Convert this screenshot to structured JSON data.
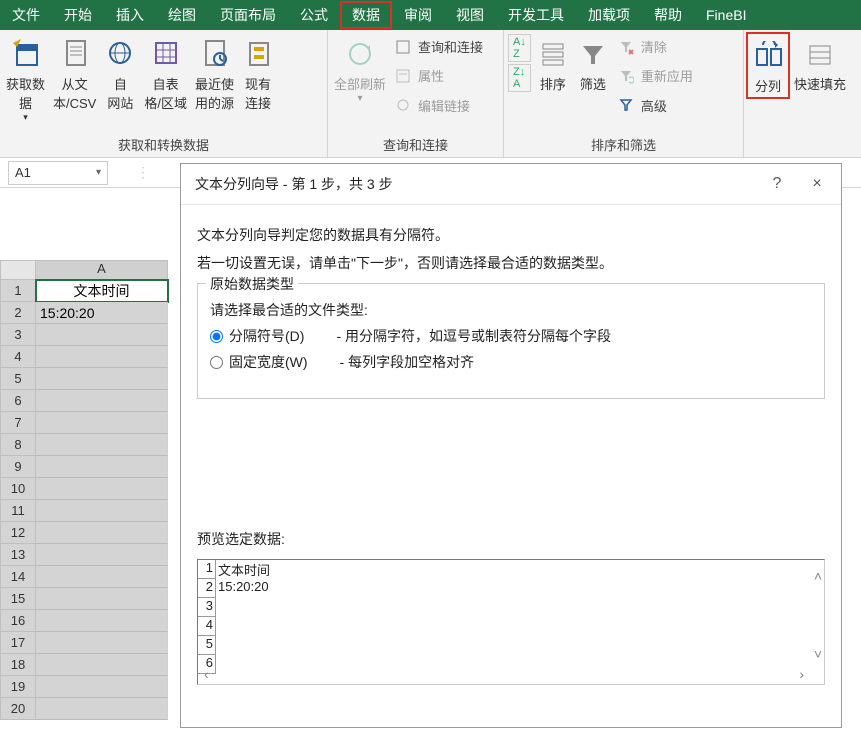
{
  "menu": {
    "items": [
      "文件",
      "开始",
      "插入",
      "绘图",
      "页面布局",
      "公式",
      "数据",
      "审阅",
      "视图",
      "开发工具",
      "加载项",
      "帮助",
      "FineBI"
    ],
    "highlightedIndex": 6
  },
  "ribbon": {
    "groups": [
      {
        "label": "获取和转换数据",
        "buttons": [
          {
            "label": "获取数\n据",
            "name": "get-data-button"
          },
          {
            "label": "从文\n本/CSV",
            "name": "from-text-csv-button"
          },
          {
            "label": "自\n网站",
            "name": "from-web-button"
          },
          {
            "label": "自表\n格/区域",
            "name": "from-table-range-button"
          },
          {
            "label": "最近使\n用的源",
            "name": "recent-sources-button"
          },
          {
            "label": "现有\n连接",
            "name": "existing-connections-button"
          }
        ]
      },
      {
        "label": "查询和连接",
        "refreshAll": "全部刷新",
        "small": [
          {
            "label": "查询和连接",
            "name": "queries-connections-button"
          },
          {
            "label": "属性",
            "name": "properties-button",
            "disabled": true
          },
          {
            "label": "编辑链接",
            "name": "edit-links-button",
            "disabled": true
          }
        ]
      },
      {
        "label": "排序和筛选",
        "sort": "排序",
        "filter": "筛选",
        "small": [
          {
            "label": "清除",
            "name": "clear-button",
            "disabled": true
          },
          {
            "label": "重新应用",
            "name": "reapply-button",
            "disabled": true
          },
          {
            "label": "高级",
            "name": "advanced-button"
          }
        ]
      },
      {
        "textToColumns": "分列",
        "flashFill": "快速填充"
      }
    ]
  },
  "nameBox": {
    "value": "A1"
  },
  "sheet": {
    "columnHeader": "A",
    "rows": [
      {
        "n": 1,
        "v": "文本时间"
      },
      {
        "n": 2,
        "v": "15:20:20"
      },
      {
        "n": 3,
        "v": ""
      },
      {
        "n": 4,
        "v": ""
      },
      {
        "n": 5,
        "v": ""
      },
      {
        "n": 6,
        "v": ""
      },
      {
        "n": 7,
        "v": ""
      },
      {
        "n": 8,
        "v": ""
      },
      {
        "n": 9,
        "v": ""
      },
      {
        "n": 10,
        "v": ""
      },
      {
        "n": 11,
        "v": ""
      },
      {
        "n": 12,
        "v": ""
      },
      {
        "n": 13,
        "v": ""
      },
      {
        "n": 14,
        "v": ""
      },
      {
        "n": 15,
        "v": ""
      },
      {
        "n": 16,
        "v": ""
      },
      {
        "n": 17,
        "v": ""
      },
      {
        "n": 18,
        "v": ""
      },
      {
        "n": 19,
        "v": ""
      },
      {
        "n": 20,
        "v": ""
      }
    ]
  },
  "dialog": {
    "title": "文本分列向导 - 第 1 步，共 3 步",
    "help": "?",
    "close": "×",
    "intro1": "文本分列向导判定您的数据具有分隔符。",
    "intro2": "若一切设置无误，请单击\"下一步\"，否则请选择最合适的数据类型。",
    "fieldsetTitle": "原始数据类型",
    "fieldsetSub": "请选择最合适的文件类型:",
    "radio1Label": "分隔符号(D)",
    "radio1Desc": "- 用分隔字符，如逗号或制表符分隔每个字段",
    "radio2Label": "固定宽度(W)",
    "radio2Desc": "- 每列字段加空格对齐",
    "previewLabel": "预览选定数据:",
    "previewRows": [
      {
        "n": 1,
        "v": "文本时间"
      },
      {
        "n": 2,
        "v": "15:20:20"
      },
      {
        "n": 3,
        "v": ""
      },
      {
        "n": 4,
        "v": ""
      },
      {
        "n": 5,
        "v": ""
      },
      {
        "n": 6,
        "v": ""
      }
    ]
  }
}
